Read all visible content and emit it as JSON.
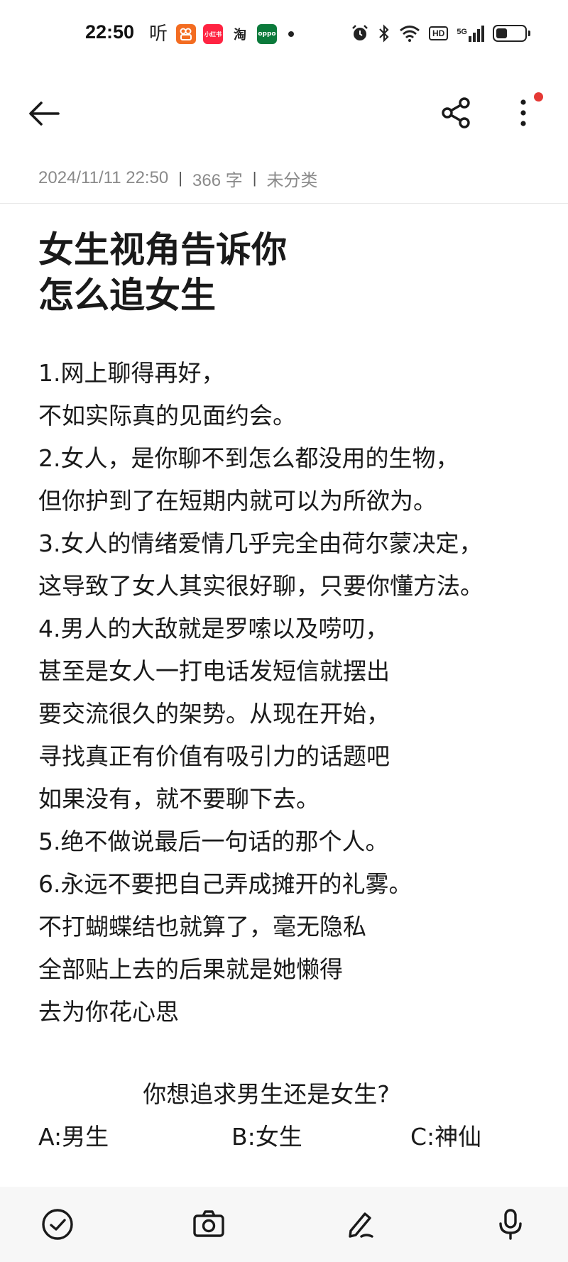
{
  "status_bar": {
    "time": "22:50",
    "notif_ting": "听",
    "notif_apps": [
      {
        "name": "kuaishou-app-icon",
        "label": "",
        "color": "#f36c21"
      },
      {
        "name": "xiaohongshu-app-icon",
        "label": "小红书",
        "color": "#ff2442"
      },
      {
        "name": "taobao-app-icon",
        "label": "淘",
        "color": "#ffffff"
      },
      {
        "name": "oppo-app-icon",
        "label": "oppo",
        "color": "#0b7a3b"
      }
    ],
    "hd_label": "HD",
    "network_label": "5G"
  },
  "note": {
    "meta": {
      "date": "2024/11/11 22:50",
      "word_count": "366 字",
      "category": "未分类"
    },
    "title_lines": [
      "女生视角告诉你",
      "怎么追女生"
    ],
    "body_lines": [
      "1.网上聊得再好，",
      "不如实际真的见面约会。",
      "2.女人，是你聊不到怎么都没用的生物，",
      "但你护到了在短期内就可以为所欲为。",
      "3.女人的情绪爱情几乎完全由荷尔蒙决定，",
      "这导致了女人其实很好聊，只要你懂方法。",
      "4.男人的大敌就是罗嗦以及唠叨，",
      "甚至是女人一打电话发短信就摆出",
      "要交流很久的架势。从现在开始，",
      "寻找真正有价值有吸引力的话题吧",
      "如果没有，就不要聊下去。",
      "5.绝不做说最后一句话的那个人。",
      "6.永远不要把自己弄成摊开的礼雾。",
      "不打蝴蝶结也就算了，毫无隐私",
      "全部贴上去的后果就是她懒得",
      "去为你花心思"
    ],
    "question": "你想追求男生还是女生?",
    "options": [
      "A:男生",
      "B:女生",
      "C:神仙"
    ]
  },
  "colors": {
    "accent_red_dot": "#e53935",
    "meta_gray": "#8a8a8a",
    "bottom_bar_bg": "#f7f7f7"
  }
}
